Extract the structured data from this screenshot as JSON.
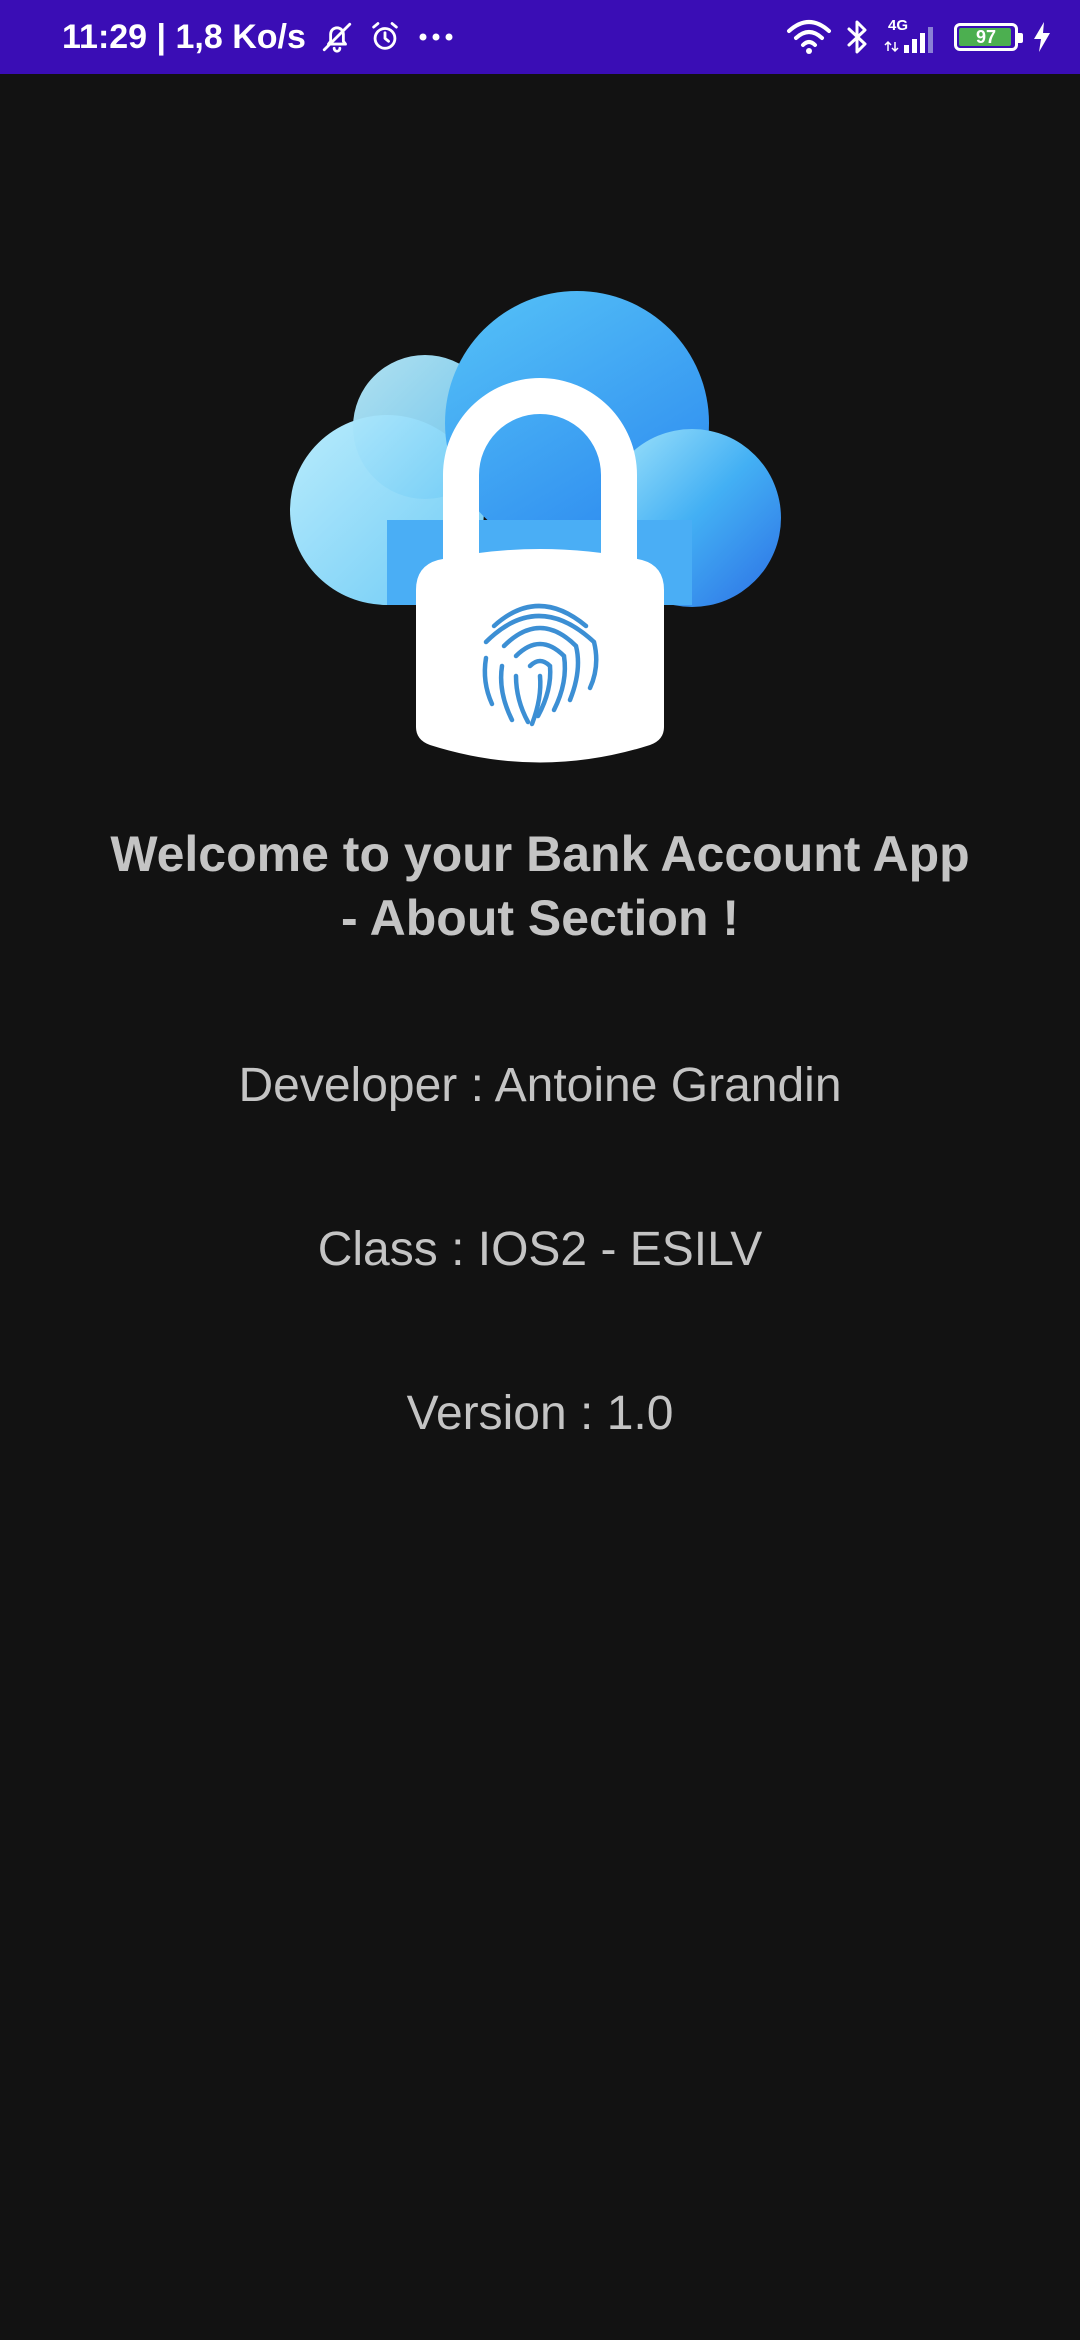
{
  "status_bar": {
    "time_speed": "11:29 | 1,8 Ko/s",
    "network_type": "4G",
    "battery_level": "97",
    "battery_fraction": 0.97,
    "background_color": "#3a0db5",
    "icons": [
      "bell-off-icon",
      "alarm-icon",
      "more-dots-icon",
      "wifi-icon",
      "bluetooth-icon",
      "signal-icon",
      "battery-icon",
      "charging-icon"
    ]
  },
  "about": {
    "welcome": "Welcome to your Bank Account App - About Section !",
    "developer": "Developer : Antoine Grandin",
    "class": "Class : IOS2 - ESILV",
    "version": "Version : 1.0"
  },
  "logo": {
    "icon": "cloud-lock-fingerprint-icon",
    "colors": [
      "#8fdcf7",
      "#3fa9f5",
      "#2f7de8"
    ]
  }
}
